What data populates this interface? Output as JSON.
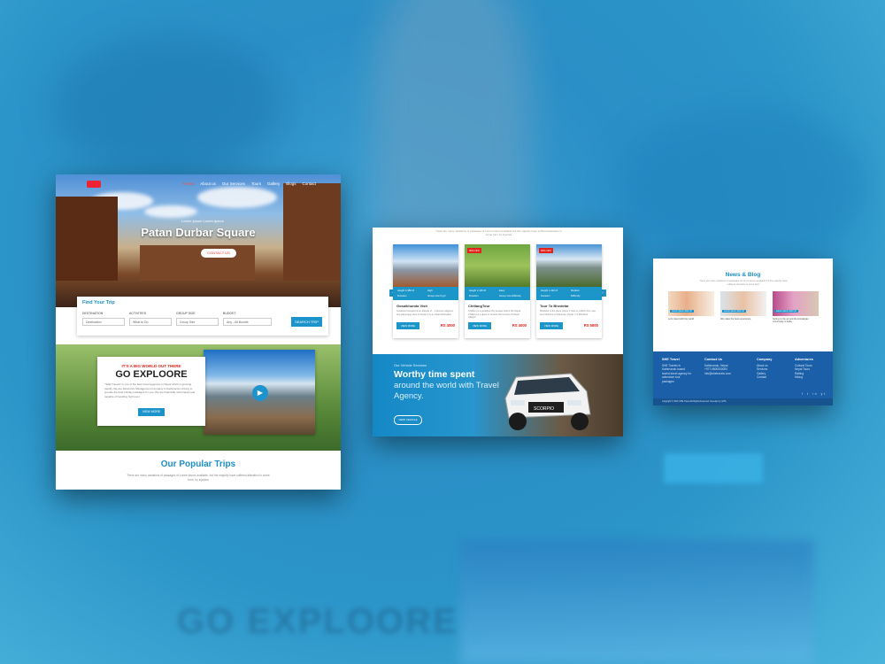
{
  "hero_page": {
    "nav": [
      "Home",
      "About us",
      "Our Services",
      "Tours",
      "Gallery",
      "Blogs",
      "Contact"
    ],
    "hero_subtitle": "Lorem Ipsum Lorem Ipsum",
    "hero_title": "Patan Durbar Square",
    "hero_button": "CONTACT US",
    "find_trip": {
      "title": "Find Your Trip",
      "labels": [
        "DESTINATION",
        "ACTIVITIES",
        "GROUP SIZE",
        "BUDGET"
      ],
      "values": [
        "Destination",
        "What to Do",
        "Group Size",
        "Any - All Bundle"
      ],
      "search": "SEARCH TRIP"
    },
    "explore": {
      "tag": "IT'S A BIG WORLD OUT THERE",
      "title": "GO EXPLOORE",
      "text": "\"SHE Travels\" is one of the best travel agencies in Nepal which is growing rapidly. We are Adventure Management Company in Kathmandu striving to provide the best holiday packages for you. We are financially well placed and capable of handling high level",
      "button": "VIEW MORE"
    },
    "popular_title": "Our Popular Trips",
    "popular_sub": "There are many variations of passages of Lorem Ipsum available, but the majority have suffered alteration in some form, by injected"
  },
  "trips_page": {
    "intro": "There are many variations of passages of Lorem Ipsum available but the majority have suffered alteration in some form by injected",
    "trips": [
      {
        "name": "Gosaikhunda Visit",
        "off": "",
        "bar": [
          "Height 4,380 M",
          "High",
          "Duration",
          "Group size 5 ppl"
        ],
        "desc": "Gosaikund located at an altitude of... a famous religious and pilgrimage sites of Nepal. It is an ideal destination",
        "price": "RS 4000"
      },
      {
        "name": "ChitlangTour",
        "off": "30% OFF",
        "bar": [
          "Height 2,100 M",
          "Easy",
          "Duration",
          "Group size Difficulty"
        ],
        "desc": "Chitlang is a paradise hilly escape before the Nepal. Chitlang is a place to witness the tourists of Newar villages.",
        "price": "RS 4000"
      },
      {
        "name": "Tour To Bhedetar",
        "off": "30% OFF",
        "bar": [
          "Height 1,420 M",
          "Medium",
          "Duration",
          "Difficulty"
        ],
        "desc": "Bhedetar is the place where it rises to 1420m from sea level that lies in Dhankuta, Nepal. It is Bhedetar",
        "price": "RS 5800"
      }
    ],
    "view_more": "VIEW MORE",
    "vehicle": {
      "tag": "Our Vehicle Services",
      "title": "Worthy time spent",
      "subtitle": "around the world with Travel Agency.",
      "button": "VIEW VEHICLE",
      "plate": "SCORPIO"
    }
  },
  "blog_page": {
    "title": "News & Blog",
    "subtitle": "There are many variations of passages of Lorem Ipsum available but the majority have suffered alteration in some form",
    "posts": [
      {
        "cap": "Lorem ipsum dolor sit",
        "text": "Let's travel with the world"
      },
      {
        "cap": "Lorem ipsum dolor sit",
        "text": "We make the best experience"
      },
      {
        "cap": "Lorem ipsum dolor sit",
        "text": "Spring to the air and the Himalayan community in India"
      }
    ],
    "footer": {
      "brand_h": "SHE Travel",
      "brand_text": "SHE Travels is Kathmandu based tourist travel agency for adventure tour packages",
      "contact_h": "Contact Us",
      "contact": [
        "Kathmandu, Nepal",
        "+977-9800000000",
        "info@shetravels.com"
      ],
      "company_h": "Company",
      "company": [
        "About us",
        "Services",
        "Gallery",
        "Contact"
      ],
      "adventure_h": "Adventures",
      "adventure": [
        "Cultural Tours",
        "Nepal Tours",
        "Rafting",
        "Hiking"
      ],
      "social": "f t in yt",
      "copyright": "Copyright © 2021 SHE Travel All Rights Reserved. Develop by: EHS"
    }
  },
  "backdrop": {
    "blurred_heading": "GO EXPLOORE",
    "colors": {
      "accent": "#1d93cc",
      "brand_red": "#e2231a",
      "footer_blue": "#1a5fa8"
    }
  }
}
